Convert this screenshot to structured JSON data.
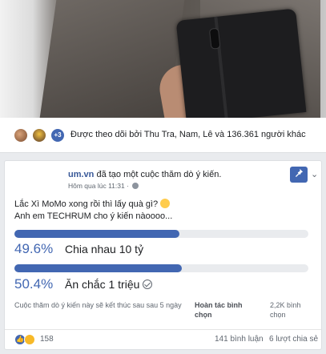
{
  "follow_bar": {
    "avatar_count": "+3",
    "text": "Được theo dõi bởi Thu Tra, Nam, Lê và 136.361 người khác"
  },
  "post": {
    "author": "um.vn",
    "action": " đã tạo một cuộc thăm dò ý kiến.",
    "timestamp": "Hôm qua lúc 11:31 ·",
    "question_line1": "Lắc Xì MoMo xong rồi thì lấy quà gì?",
    "question_line2": "Anh em TECHRUM cho ý kiến nàoooo...",
    "poll": {
      "options": [
        {
          "percent": "49.6%",
          "label": "Chia nhau 10 tỷ",
          "fraction": 0.496,
          "selected": false
        },
        {
          "percent": "50.4%",
          "label": "Ăn chắc 1 triệu",
          "fraction": 0.504,
          "selected": true
        }
      ],
      "ends_text": "Cuộc thăm dò ý kiến này sẽ kết thúc sau sau 5 ngày",
      "status": "Hoàn tác bình chọn",
      "votes": "2,2K bình chọn"
    },
    "stats": {
      "reactions": "158",
      "comments": "141 bình luận",
      "shares": "6 lượt chia sẻ"
    }
  },
  "icons": {
    "pin": "pin-icon",
    "chevron": "chevron-down-icon",
    "globe": "globe-icon",
    "like": "like-reaction-icon",
    "haha": "haha-reaction-icon"
  },
  "colors": {
    "accent": "#4267b2",
    "link": "#385898",
    "track": "#e9ebee"
  }
}
